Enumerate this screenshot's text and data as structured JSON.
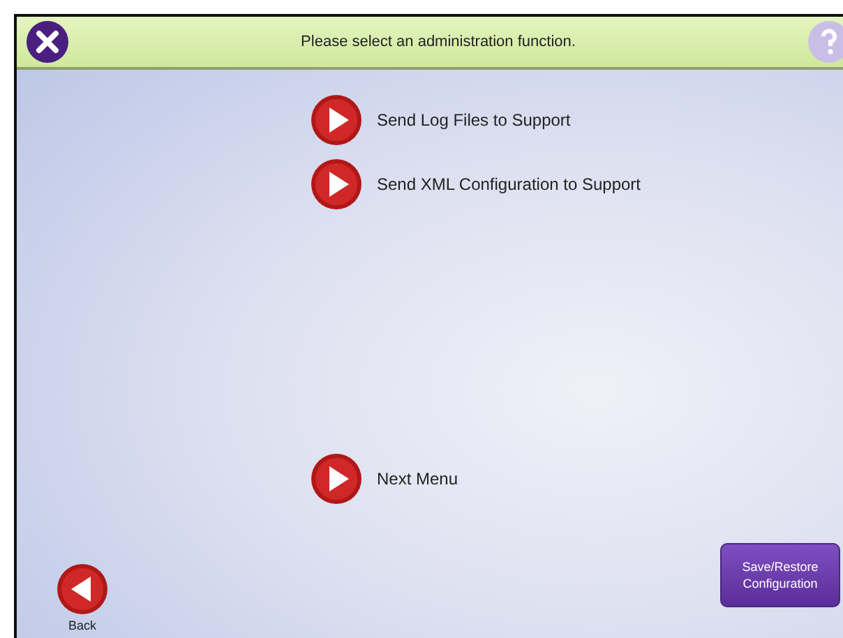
{
  "header": {
    "title": "Please select an administration function."
  },
  "menu_items": [
    {
      "label": "Send Log Files to Support"
    },
    {
      "label": "Send XML Configuration to Support"
    }
  ],
  "next_menu": {
    "label": "Next Menu"
  },
  "back": {
    "label": "Back"
  },
  "save_restore_button": {
    "label": "Save/Restore Configuration"
  }
}
